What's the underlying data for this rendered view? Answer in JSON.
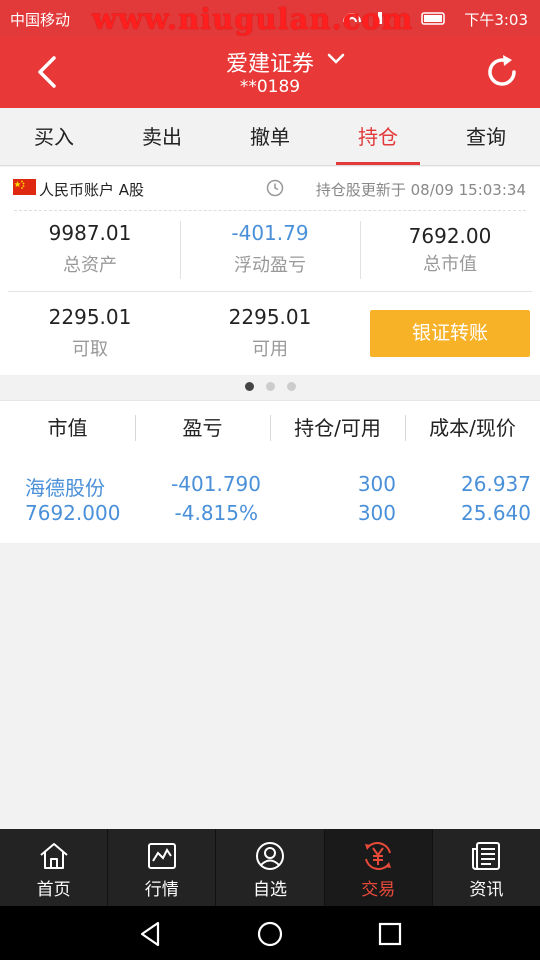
{
  "status_bar": {
    "carrier": "中国移动",
    "watermark": "www.niugulan.com",
    "time": "下午3:03"
  },
  "header": {
    "title": "爱建证券",
    "account": "**0189"
  },
  "tabs": [
    {
      "label": "买入",
      "active": false
    },
    {
      "label": "卖出",
      "active": false
    },
    {
      "label": "撤单",
      "active": false
    },
    {
      "label": "持仓",
      "active": true
    },
    {
      "label": "查询",
      "active": false
    }
  ],
  "account": {
    "label": "人民币账户 A股",
    "updated": "持仓股更新于 08/09 15:03:34",
    "total_assets": {
      "value": "9987.01",
      "label": "总资产"
    },
    "floating_pl": {
      "value": "-401.79",
      "label": "浮动盈亏"
    },
    "market_value": {
      "value": "7692.00",
      "label": "总市值"
    },
    "withdrawable": {
      "value": "2295.01",
      "label": "可取"
    },
    "available": {
      "value": "2295.01",
      "label": "可用"
    },
    "transfer_button": "银证转账"
  },
  "pager": {
    "count": 3,
    "active": 0
  },
  "holdings": {
    "headers": [
      "市值",
      "盈亏",
      "持仓/可用",
      "成本/现价"
    ],
    "rows": [
      {
        "name": "海德股份",
        "market_value": "7692.000",
        "pl": "-401.790",
        "pl_pct": "-4.815%",
        "position": "300",
        "available": "300",
        "cost": "26.937",
        "price": "25.640"
      }
    ]
  },
  "bottom_nav": [
    {
      "label": "首页",
      "icon": "home-icon",
      "active": false
    },
    {
      "label": "行情",
      "icon": "chart-icon",
      "active": false
    },
    {
      "label": "自选",
      "icon": "user-icon",
      "active": false
    },
    {
      "label": "交易",
      "icon": "yuan-icon",
      "active": true
    },
    {
      "label": "资讯",
      "icon": "news-icon",
      "active": false
    }
  ],
  "colors": {
    "brand_red": "#e83838",
    "accent_orange": "#f7b228",
    "value_blue": "#4a90d9"
  }
}
